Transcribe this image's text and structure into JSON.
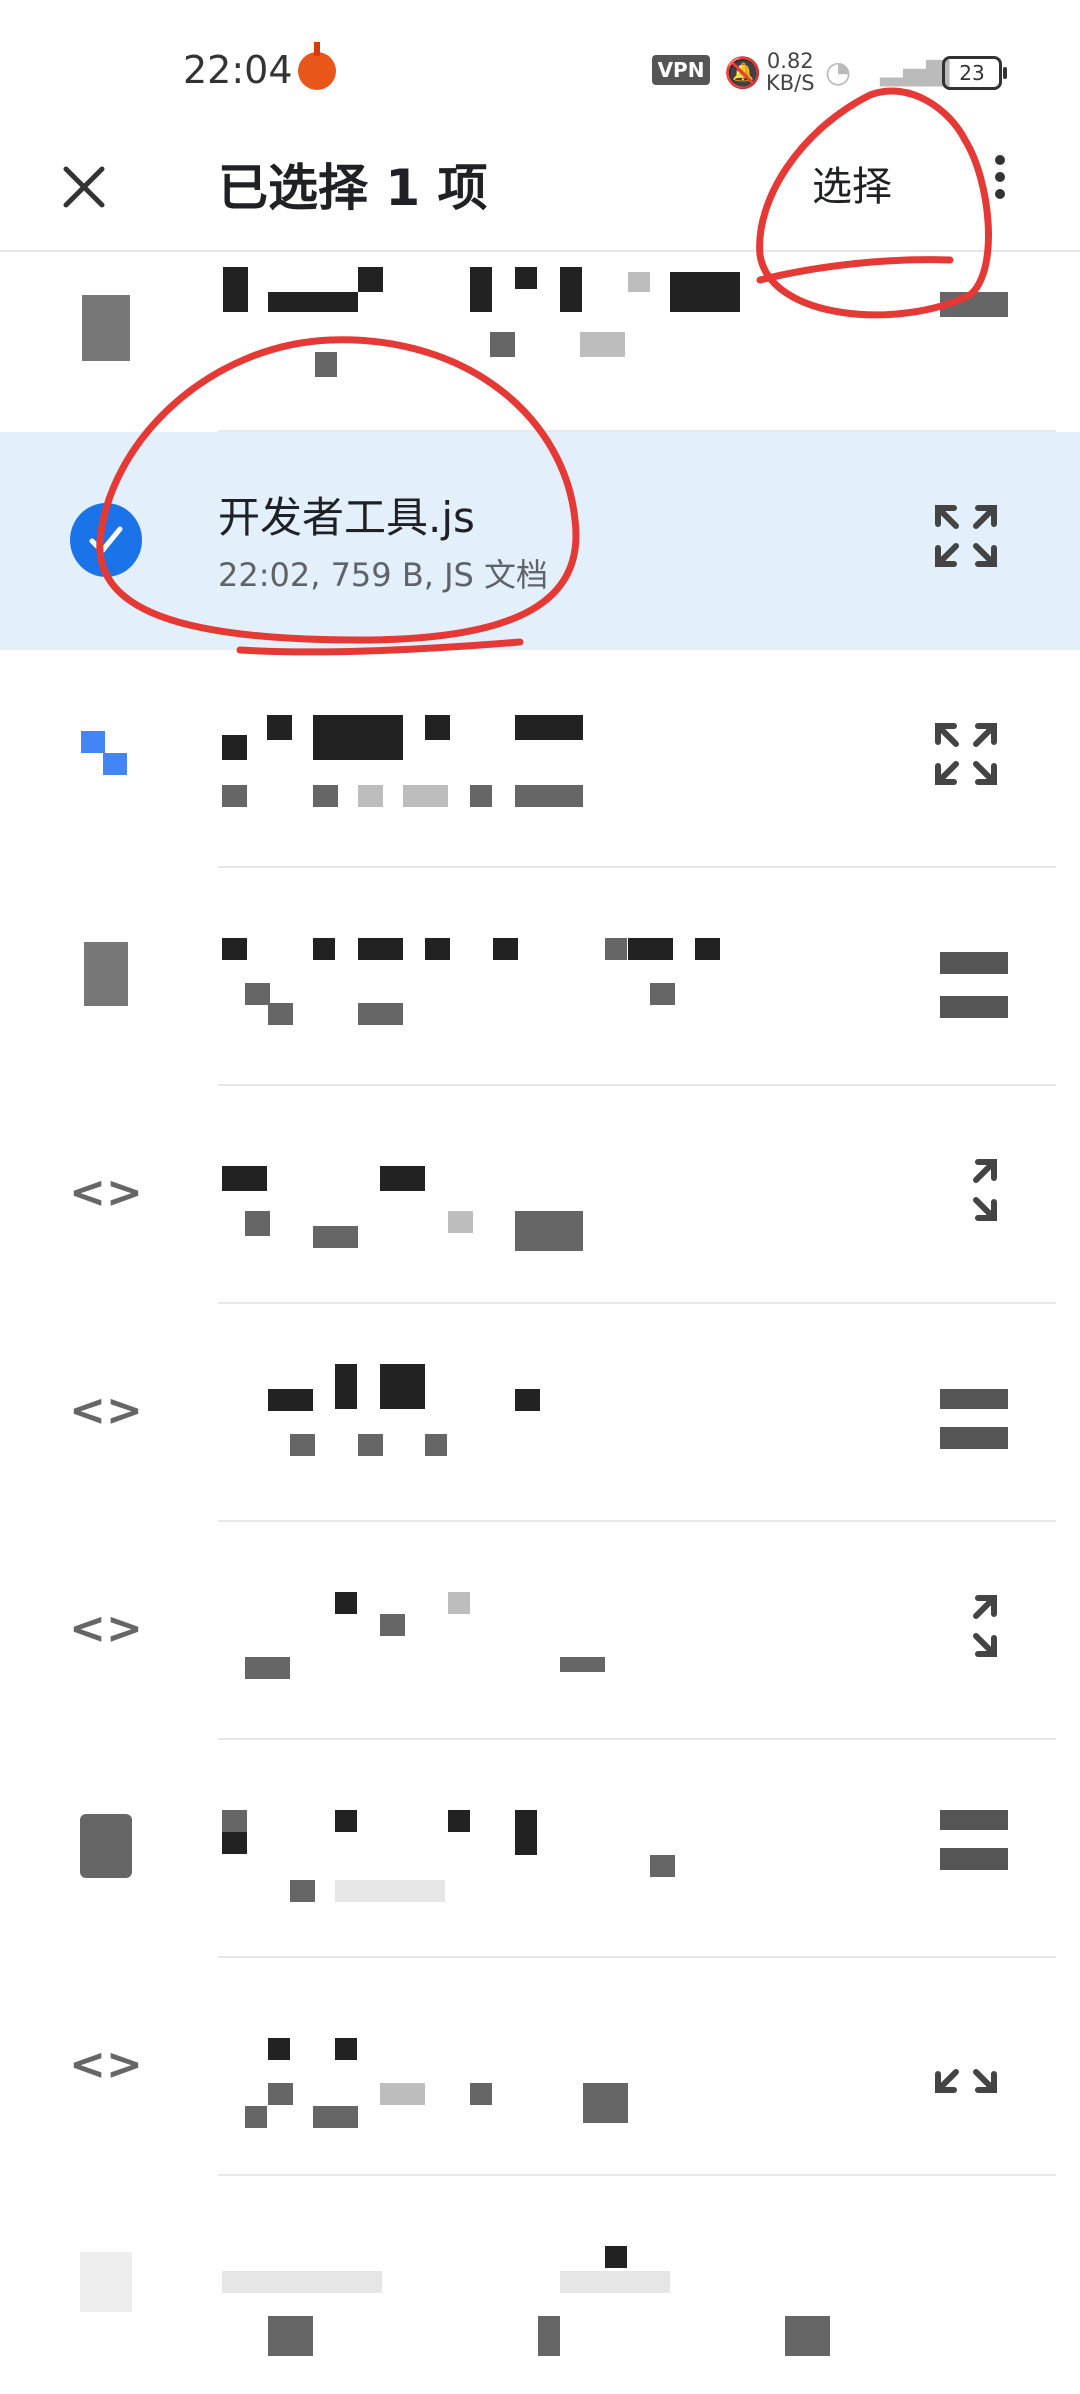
{
  "status_bar": {
    "time": "22:04",
    "vpn": "VPN",
    "net_speed_value": "0.82",
    "net_speed_unit": "KB/S",
    "battery": "23"
  },
  "app_bar": {
    "title": "已选择 1 项",
    "select_label": "选择"
  },
  "selected_file": {
    "name": "开发者工具.js",
    "meta": "22:02, 759 B, JS 文档"
  },
  "colors": {
    "accent": "#1a73e8",
    "selected_row": "#e3f0fc",
    "annotation_red": "#e53935"
  },
  "icons": {
    "close": "close-icon",
    "more": "more-vert-icon",
    "check": "check-circle-icon",
    "expand": "expand-icon",
    "code": "code-icon"
  }
}
